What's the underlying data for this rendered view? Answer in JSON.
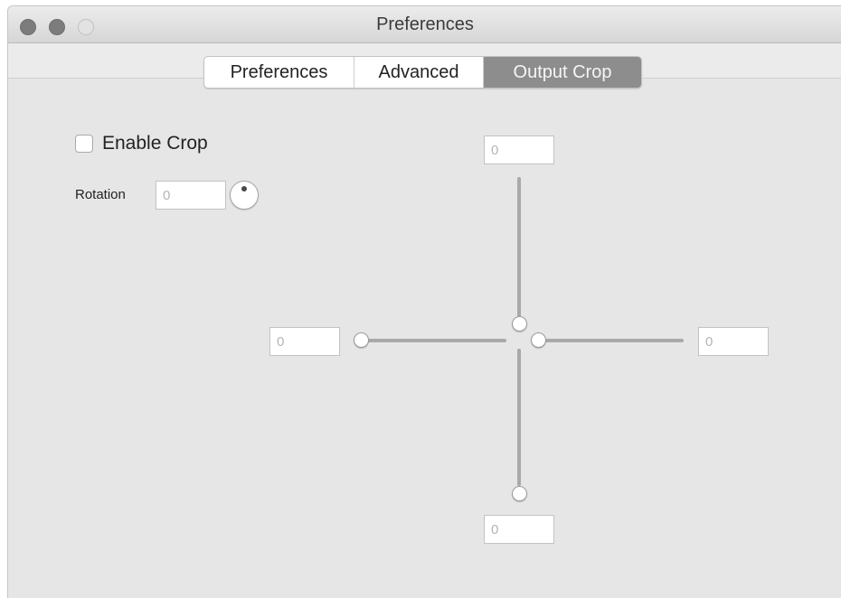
{
  "window": {
    "title": "Preferences"
  },
  "tabs": [
    {
      "label": "Preferences",
      "selected": false
    },
    {
      "label": "Advanced",
      "selected": false
    },
    {
      "label": "Output Crop",
      "selected": true
    }
  ],
  "crop": {
    "enable_label": "Enable Crop",
    "enabled": false,
    "rotation_label": "Rotation",
    "rotation_placeholder": "0",
    "top_placeholder": "0",
    "left_placeholder": "0",
    "right_placeholder": "0",
    "bottom_placeholder": "0"
  },
  "colors": {
    "selected_tab": "#8d8d8d",
    "window_bg": "#e6e6e6",
    "track": "#a9a9a9"
  },
  "icons": {
    "close": "close-icon",
    "minimize": "minimize-icon",
    "zoom": "zoom-icon",
    "rotation": "rotation-dial-icon"
  }
}
